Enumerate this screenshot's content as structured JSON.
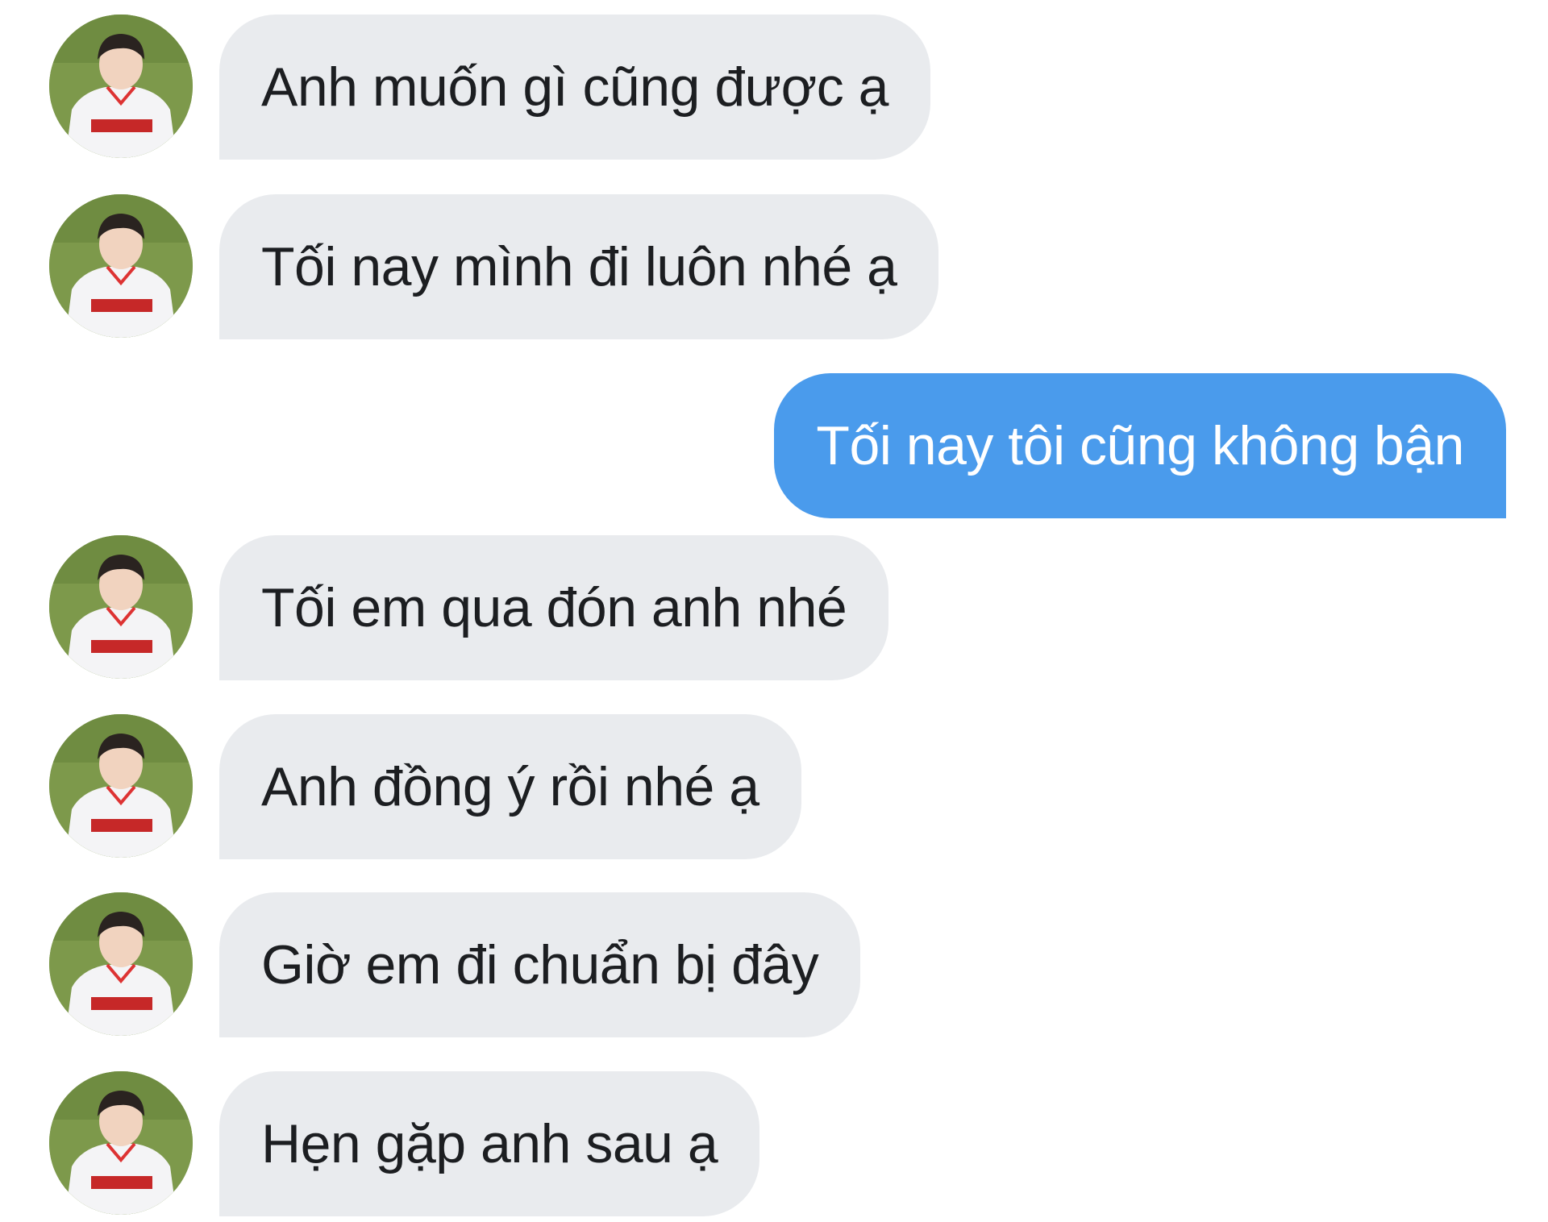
{
  "conversation": {
    "messages": [
      {
        "direction": "incoming",
        "text": "Anh muốn gì cũng được ạ",
        "avatar": "profile-photo"
      },
      {
        "direction": "incoming",
        "text": "Tối nay mình đi luôn nhé ạ",
        "avatar": "profile-photo"
      },
      {
        "direction": "outgoing",
        "text": "Tối nay tôi cũng không bận"
      },
      {
        "direction": "incoming",
        "text": "Tối em qua đón anh nhé",
        "avatar": "profile-photo"
      },
      {
        "direction": "incoming",
        "text": "Anh đồng ý rồi nhé ạ",
        "avatar": "profile-photo"
      },
      {
        "direction": "incoming",
        "text": "Giờ em đi chuẩn bị đây",
        "avatar": "profile-photo"
      },
      {
        "direction": "incoming",
        "text": "Hẹn gặp anh sau ạ",
        "avatar": "profile-photo"
      }
    ]
  },
  "colors": {
    "incoming_bubble": "#e9ebee",
    "outgoing_bubble": "#4a9bec",
    "incoming_text": "#1c1e21",
    "outgoing_text": "#ffffff"
  }
}
